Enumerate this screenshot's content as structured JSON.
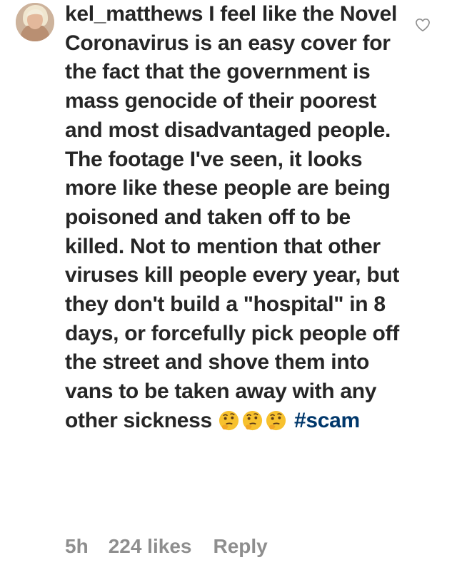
{
  "comment": {
    "username": "kel_matthews",
    "text": "I feel like the Novel Coronavirus is an easy cover for the fact that the government is mass genocide of their poorest and most disadvantaged people. The footage I've seen, it looks more like these people are being poisoned and taken off to be killed. Not to mention that other viruses kill people every year, but they don't build a \"hospital\" in 8 days, or forcefully pick people off the street and shove them into vans to be taken away with any other sickness",
    "emojis": [
      "thinking-face-emoji",
      "thinking-face-emoji",
      "thinking-face-emoji"
    ],
    "hashtag": "#scam",
    "time": "5h",
    "likes": "224 likes",
    "reply_label": "Reply"
  },
  "icons": {
    "avatar": "user-avatar",
    "like": "heart-icon"
  },
  "colors": {
    "text": "#262626",
    "meta": "#8e8e8e",
    "hashtag": "#00376b",
    "background": "#ffffff"
  }
}
